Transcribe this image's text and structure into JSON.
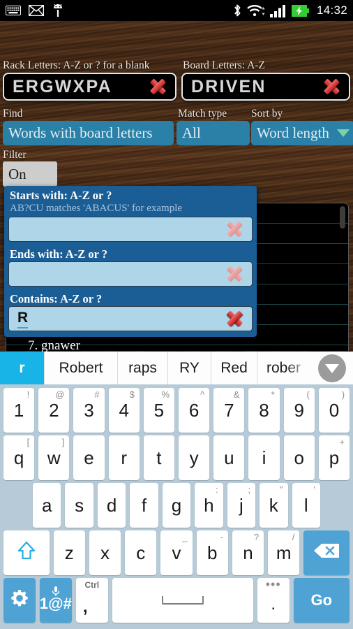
{
  "statusbar": {
    "icons_left": [
      "keyboard-icon",
      "envelope-icon",
      "android-icon"
    ],
    "icons_right": [
      "bluetooth-icon",
      "wifi-icon",
      "signal-icon",
      "battery-charging-icon"
    ],
    "clock": "14:32"
  },
  "form": {
    "rack_label": "Rack Letters: A-Z or ? for a blank",
    "rack_value": "ERGWXPA",
    "board_label": "Board Letters: A-Z",
    "board_value": "DRIVEN",
    "find_label": "Find",
    "find_value": "Words with board letters",
    "match_label": "Match type",
    "match_value": "All",
    "sort_label": "Sort by",
    "sort_value": "Word length",
    "filter_label": "Filter",
    "filter_value": "On"
  },
  "dialog": {
    "starts_title": "Starts with: A-Z or ?",
    "starts_hint": "AB?CU matches 'ABACUS' for example",
    "starts_value": "",
    "ends_title": "Ends with: A-Z or ?",
    "ends_value": "",
    "contains_title": "Contains: A-Z or ?",
    "contains_value": "R"
  },
  "results": {
    "visible_entry": "7. gnawer"
  },
  "suggestions": [
    {
      "label": "r",
      "active": true
    },
    {
      "label": "Robert",
      "active": false
    },
    {
      "label": "raps",
      "active": false
    },
    {
      "label": "RY",
      "active": false
    },
    {
      "label": "Red",
      "active": false
    },
    {
      "label": "rober",
      "active": false
    }
  ],
  "keyboard": {
    "row1": [
      {
        "k": "1",
        "s": "!"
      },
      {
        "k": "2",
        "s": "@"
      },
      {
        "k": "3",
        "s": "#"
      },
      {
        "k": "4",
        "s": "$"
      },
      {
        "k": "5",
        "s": "%"
      },
      {
        "k": "6",
        "s": "^"
      },
      {
        "k": "7",
        "s": "&"
      },
      {
        "k": "8",
        "s": "*"
      },
      {
        "k": "9",
        "s": "("
      },
      {
        "k": "0",
        "s": ")"
      }
    ],
    "row2": [
      {
        "k": "q",
        "s": "["
      },
      {
        "k": "w",
        "s": "]"
      },
      {
        "k": "e",
        "s": ""
      },
      {
        "k": "r",
        "s": ""
      },
      {
        "k": "t",
        "s": ""
      },
      {
        "k": "y",
        "s": ""
      },
      {
        "k": "u",
        "s": ""
      },
      {
        "k": "i",
        "s": ""
      },
      {
        "k": "o",
        "s": ""
      },
      {
        "k": "p",
        "s": "+"
      }
    ],
    "row3": [
      {
        "k": "a",
        "s": ""
      },
      {
        "k": "s",
        "s": ""
      },
      {
        "k": "d",
        "s": ""
      },
      {
        "k": "f",
        "s": ""
      },
      {
        "k": "g",
        "s": ""
      },
      {
        "k": "h",
        "s": ":"
      },
      {
        "k": "j",
        "s": ";"
      },
      {
        "k": "k",
        "s": "\""
      },
      {
        "k": "l",
        "s": "'"
      }
    ],
    "row4": [
      {
        "k": "z",
        "s": ""
      },
      {
        "k": "x",
        "s": ""
      },
      {
        "k": "c",
        "s": ""
      },
      {
        "k": "v",
        "s": "_"
      },
      {
        "k": "b",
        "s": "-"
      },
      {
        "k": "n",
        "s": "?"
      },
      {
        "k": "m",
        "s": "/"
      }
    ],
    "shift_label": "shift-icon",
    "backspace_label": "backspace-icon",
    "settings_label": "gear-icon",
    "symbols_label": "1@#",
    "mic_label": "mic-icon",
    "comma_label": ",",
    "ctrl_label": "Ctrl",
    "space_label": "space-icon",
    "period_label": ".",
    "more_label": "•••",
    "go_label": "Go"
  },
  "colors": {
    "accent_teal": "#2a80a6",
    "dialog_blue": "#1b5e96",
    "field_light": "#aed6e8",
    "key_blue": "#4fa3d4",
    "suggest_active": "#18b4e8",
    "red_x": "#c01d1d"
  }
}
